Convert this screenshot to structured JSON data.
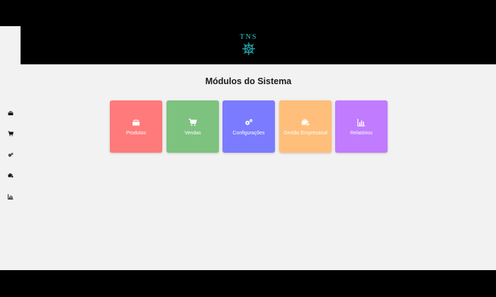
{
  "logo": {
    "text": "TNS"
  },
  "page_title": "Módulos do Sistema",
  "sidebar": {
    "items": [
      {
        "icon": "box-icon"
      },
      {
        "icon": "cart-icon"
      },
      {
        "icon": "gears-icon"
      },
      {
        "icon": "business-icon"
      },
      {
        "icon": "chart-icon"
      }
    ]
  },
  "modules": [
    {
      "label": "Produtos",
      "icon": "box-icon",
      "color": "#ff7a7a"
    },
    {
      "label": "Vendas",
      "icon": "cart-icon",
      "color": "#7dc27f"
    },
    {
      "label": "Configurações",
      "icon": "gears-icon",
      "color": "#7b7bff"
    },
    {
      "label": "Gestão Empresarial",
      "icon": "business-icon",
      "color": "#ffbe7a"
    },
    {
      "label": "Relatórios",
      "icon": "chart-icon",
      "color": "#c07bff"
    }
  ],
  "colors": {
    "background": "#f2f2f2",
    "header": "#000000",
    "logo": "#27c3c9"
  }
}
